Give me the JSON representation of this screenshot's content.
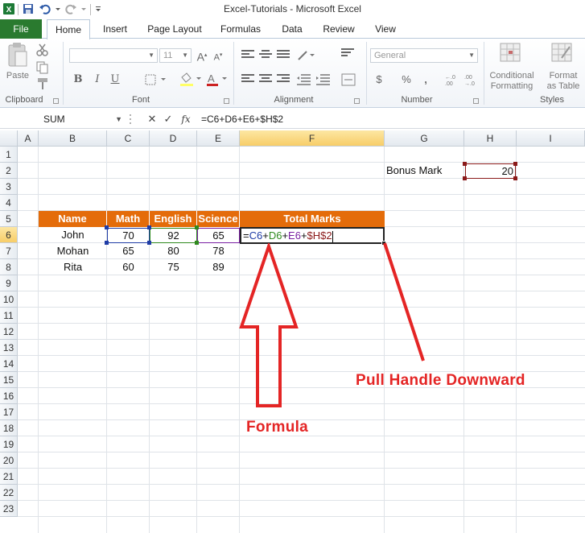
{
  "window": {
    "title": "Excel-Tutorials  -  Microsoft Excel"
  },
  "ribbon": {
    "tabs": [
      "File",
      "Home",
      "Insert",
      "Page Layout",
      "Formulas",
      "Data",
      "Review",
      "View"
    ],
    "groups": {
      "clipboard": {
        "label": "Clipboard",
        "paste_label": "Paste"
      },
      "font": {
        "label": "Font",
        "font_size": "11",
        "bold": "B",
        "italic": "I",
        "underline": "U"
      },
      "alignment": {
        "label": "Alignment"
      },
      "number": {
        "label": "Number",
        "format": "General",
        "currency": "$",
        "percent": "%",
        "comma": ","
      },
      "styles": {
        "label": "Styles",
        "conditional_1": "Conditional",
        "conditional_2": "Formatting",
        "table_1": "Format",
        "table_2": "as Table"
      }
    }
  },
  "formula_bar": {
    "name_box": "SUM",
    "fx": "fx",
    "formula": "=C6+D6+E6+$H$2"
  },
  "sheet": {
    "columns": [
      "A",
      "B",
      "C",
      "D",
      "E",
      "F",
      "G",
      "H",
      "I"
    ],
    "rows": [
      "1",
      "2",
      "3",
      "4",
      "5",
      "6",
      "7",
      "8",
      "9",
      "10",
      "11",
      "12",
      "13",
      "14",
      "15",
      "16",
      "17",
      "18",
      "19",
      "20",
      "21",
      "22",
      "23"
    ],
    "bonus_label": "Bonus Mark",
    "bonus_value": "20",
    "table_headers": [
      "Name",
      "Math",
      "English",
      "Science",
      "Total Marks"
    ],
    "data_rows": [
      {
        "name": "John",
        "math": "70",
        "english": "92",
        "science": "65"
      },
      {
        "name": "Mohan",
        "math": "65",
        "english": "80",
        "science": "78"
      },
      {
        "name": "Rita",
        "math": "60",
        "english": "75",
        "science": "89"
      }
    ],
    "active_cell_formula": {
      "eq": "=",
      "c": "C6",
      "p1": "+",
      "d": "D6",
      "p2": "+",
      "e": "E6",
      "p3": "+",
      "h": "$H$2"
    }
  },
  "annotations": {
    "formula_label": "Formula",
    "handle_label": "Pull Handle Downward",
    "color": "#e42525"
  }
}
